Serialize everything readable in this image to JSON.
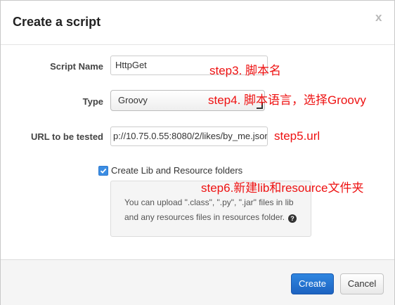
{
  "dialog": {
    "title": "Create a script",
    "close_label": "x"
  },
  "form": {
    "script_name": {
      "label": "Script Name",
      "value": "HttpGet"
    },
    "type": {
      "label": "Type",
      "selected": "Groovy"
    },
    "url": {
      "label": "URL to be tested",
      "value": "p://10.75.0.55:8080/2/likes/by_me.json"
    },
    "create_lib": {
      "label": "Create Lib and Resource folders",
      "checked": true,
      "info_line1": "You can upload \".class\", \".py\", \".jar\" files in lib",
      "info_line2": "and any resources files in resources folder.",
      "help_label": "?"
    }
  },
  "annotations": {
    "step3": "step3. 脚本名",
    "step4": "step4. 脚本语言，选择Groovy",
    "step5": "step5.url",
    "step6": "step6.新建lib和resource文件夹"
  },
  "footer": {
    "create_label": "Create",
    "cancel_label": "Cancel"
  },
  "colors": {
    "primary": "#1d63c1",
    "annotation": "#ee1111",
    "checkbox": "#3b8de3"
  }
}
